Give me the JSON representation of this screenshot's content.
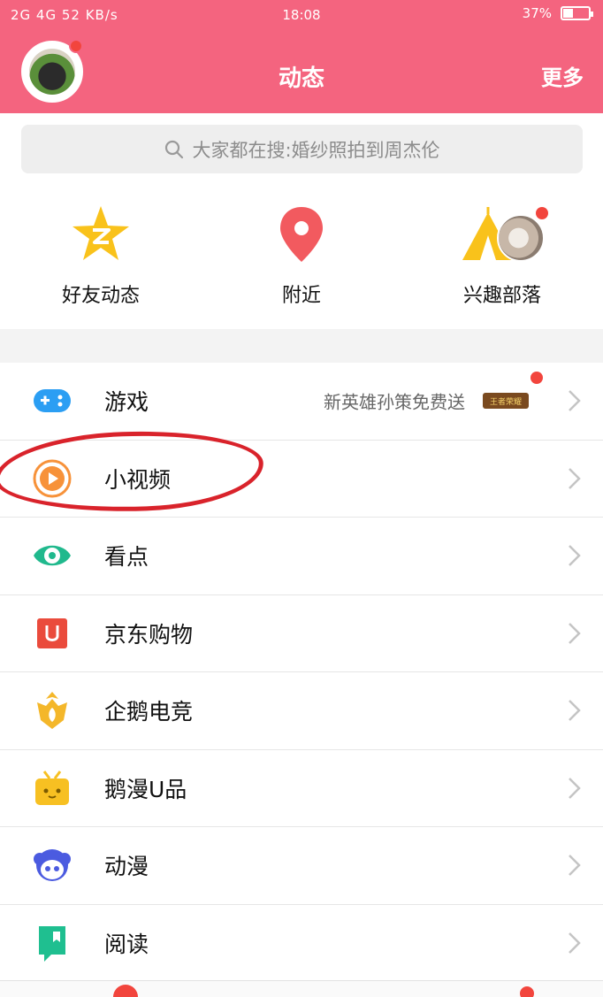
{
  "status_bar": {
    "left": "2G 4G 52 KB/s",
    "time": "18:08",
    "battery": "37%",
    "battery_level": 0.37
  },
  "header": {
    "title": "动态",
    "more_label": "更多"
  },
  "search": {
    "placeholder": "大家都在搜:婚纱照拍到周杰伦"
  },
  "quick_actions": [
    {
      "label": "好友动态",
      "icon": "star-icon",
      "color": "#f9c21b"
    },
    {
      "label": "附近",
      "icon": "location-pin-icon",
      "color": "#f25a5f"
    },
    {
      "label": "兴趣部落",
      "icon": "tent-icon",
      "color": "#f9c21b"
    }
  ],
  "menu": [
    {
      "label": "游戏",
      "icon": "gamepad-icon",
      "extra": "新英雄孙策免费送",
      "badge": "王者荣耀"
    },
    {
      "label": "小视频",
      "icon": "video-play-icon"
    },
    {
      "label": "看点",
      "icon": "eye-icon"
    },
    {
      "label": "京东购物",
      "icon": "shopping-bag-icon"
    },
    {
      "label": "企鹅电竞",
      "icon": "esports-crown-icon"
    },
    {
      "label": "鹅漫U品",
      "icon": "gift-box-icon"
    },
    {
      "label": "动漫",
      "icon": "anime-character-icon"
    },
    {
      "label": "阅读",
      "icon": "book-icon"
    }
  ],
  "colors": {
    "header": "#f4647f",
    "badge_dot": "#f2453d",
    "annotation": "#d9232b"
  }
}
